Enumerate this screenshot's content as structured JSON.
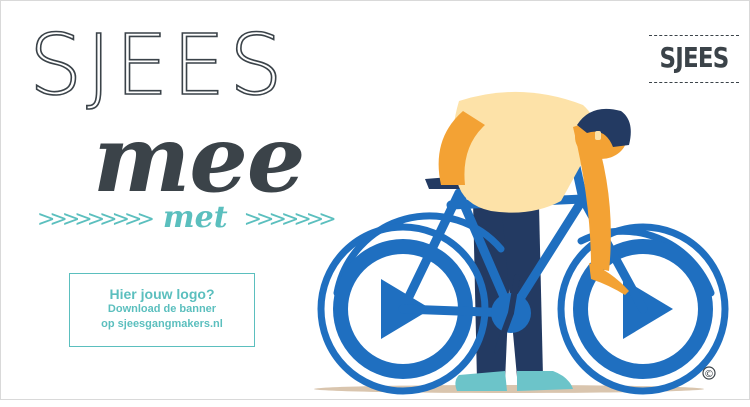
{
  "banner": {
    "title_top": "SJEES",
    "title_main": "mee",
    "arrows_left": ">>>>>>>>>",
    "subtitle": "met",
    "arrows_right": ">>>>>>>",
    "logo_box": {
      "heading": "Hier jouw logo?",
      "line1": "Download de banner",
      "line2": "op sjeesgangmakers.nl"
    },
    "brand_badge": "SJEES",
    "illustration": "man-with-bicycle-play-wheels",
    "copyright_mark": "©"
  },
  "colors": {
    "dark": "#3b4349",
    "teal": "#5bbfbe",
    "blue": "#1f6fc0",
    "skin": "#f3a234",
    "shirt": "#fde2a8",
    "pants": "#233a62",
    "shoes": "#6cc4c9"
  }
}
